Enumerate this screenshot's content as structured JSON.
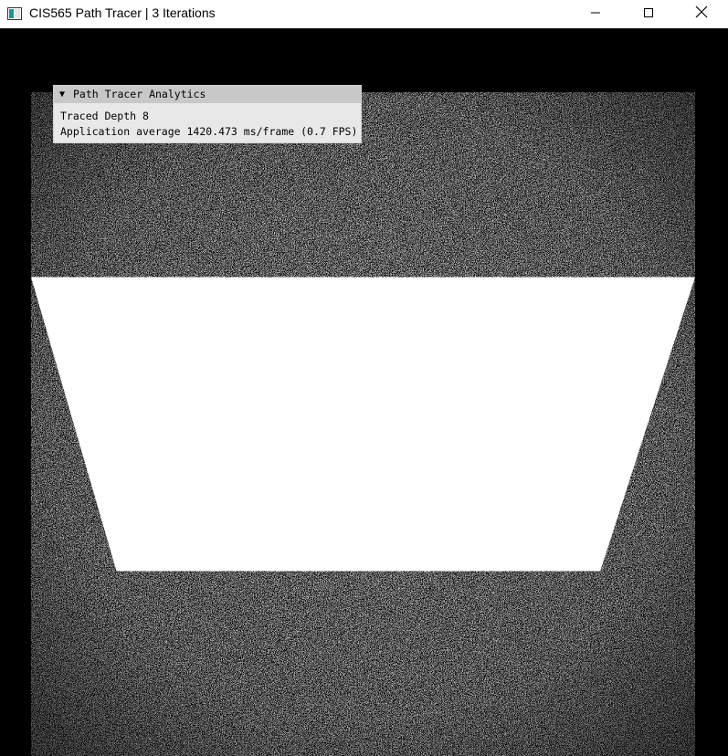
{
  "window": {
    "title": "CIS565 Path Tracer | 3 Iterations",
    "icon": "app-window-icon",
    "controls": {
      "minimize_icon": "minimize-icon",
      "maximize_icon": "maximize-icon",
      "close_icon": "close-icon"
    }
  },
  "analytics_panel": {
    "collapse_icon": "▼",
    "title": "Path Tracer Analytics",
    "traced_depth_text": "Traced Depth 8",
    "app_average_text": "Application average 1420.473 ms/frame (0.7 FPS)"
  },
  "render": {
    "description_colors": {
      "noise_light": "#ffffff",
      "noise_dark": "#000000",
      "light_source": "#ffffff"
    }
  }
}
